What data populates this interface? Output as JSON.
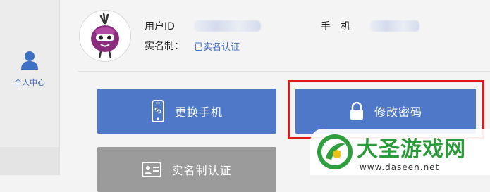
{
  "sidebar": {
    "items": [
      {
        "label": "个人中心",
        "icon": "person-icon"
      }
    ]
  },
  "profile": {
    "user_id_label": "用户ID",
    "phone_label": "手　机",
    "realname_label": "实名制：",
    "realname_status": "已实名认证"
  },
  "actions": {
    "change_phone": "更换手机",
    "change_password": "修改密码",
    "realname_auth": "实名制认证"
  },
  "colors": {
    "button_blue": "#4f78c9",
    "button_gray": "#9b9b9b",
    "highlight_red": "#e11818",
    "link_blue": "#3f6fc3"
  },
  "watermark": {
    "title": "大圣游戏网",
    "url": "www.daseen.net"
  }
}
